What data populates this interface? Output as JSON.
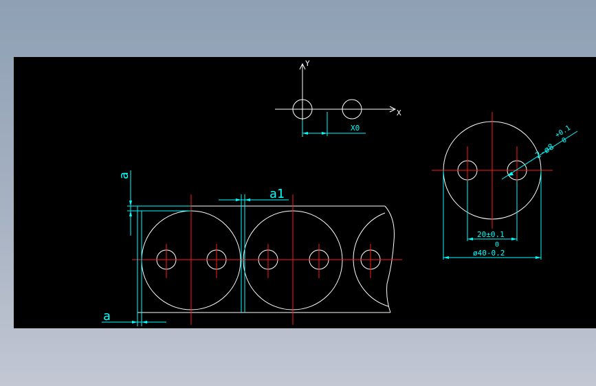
{
  "colors": {
    "background": "#000000",
    "outline": "#ffffff",
    "centerline": "#ff1a1a",
    "dimension": "#00ffff"
  },
  "axes": {
    "x_label": "X",
    "y_label": "Y",
    "x0_label": "X0"
  },
  "strip": {
    "a_label": "a",
    "a1_label": "a1"
  },
  "part_view": {
    "hole_callout": "2-ø8",
    "hole_tol_upper": "+0.1",
    "hole_tol_lower": "0",
    "pitch_dim": "20±0.1",
    "dia_tol_upper": "0",
    "dia_dim": "ø40-0.2"
  }
}
